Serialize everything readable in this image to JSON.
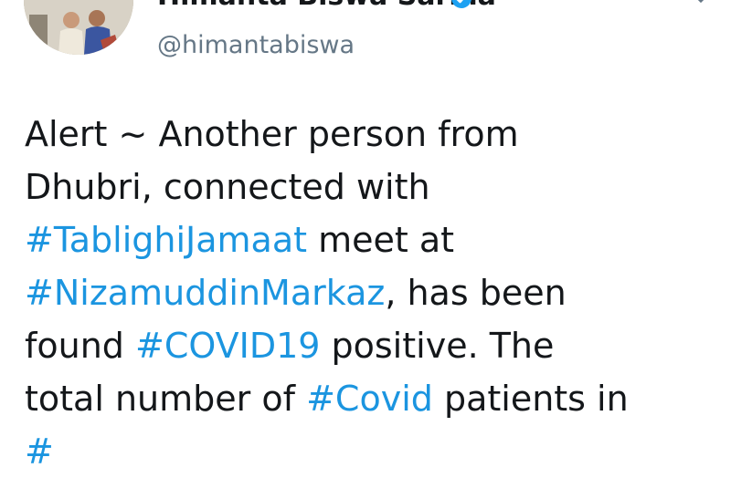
{
  "author": {
    "name": "Himanta Biswa Sarma",
    "handle": "@himantabiswa",
    "verified": true,
    "avatar_icon": "profile-photo"
  },
  "colors": {
    "text": "#14171a",
    "hashtag": "#1b95e0",
    "handle": "#657786"
  },
  "tweet": {
    "lines": [
      [
        {
          "text": "Alert ~ Another person from"
        }
      ],
      [
        {
          "text": "Dhubri, connected with"
        }
      ],
      [
        {
          "text": "#TablighiJamaat",
          "tag": true
        },
        {
          "text": " meet at"
        }
      ],
      [
        {
          "text": "#NizamuddinMarkaz",
          "tag": true
        },
        {
          "text": ", has been"
        }
      ],
      [
        {
          "text": "found "
        },
        {
          "text": "#COVID19",
          "tag": true
        },
        {
          "text": " positive. The"
        }
      ],
      [
        {
          "text": "total number of "
        },
        {
          "text": "#Covid",
          "tag": true
        },
        {
          "text": " patients in"
        }
      ]
    ]
  }
}
